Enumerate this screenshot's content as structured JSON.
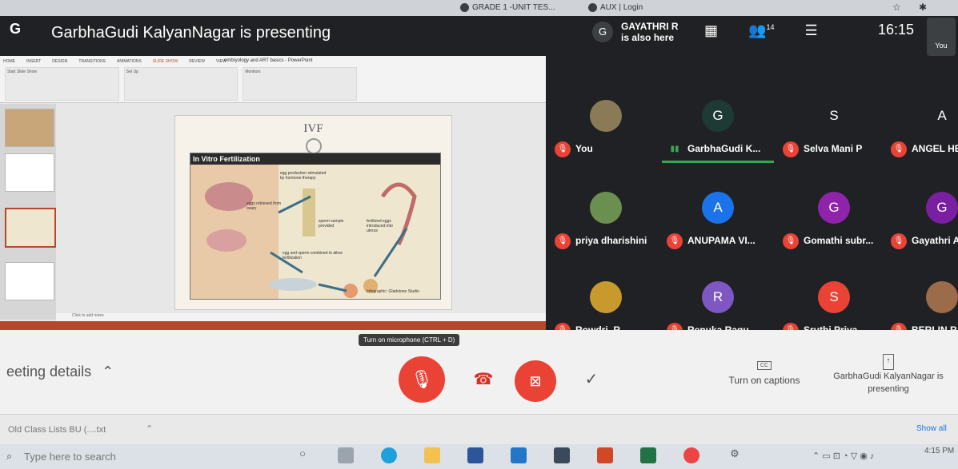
{
  "browser": {
    "tab1": "GRADE 1 -UNIT TES...",
    "tab2": "AUX | Login"
  },
  "header": {
    "logo": "G",
    "presenting_title": "GarbhaGudi KalyanNagar is presenting",
    "also_here_avatar": "G",
    "also_here_name": "GAYATHRI R",
    "also_here_text": "is also here",
    "people_count": "14",
    "time": "16:15",
    "you_label": "You"
  },
  "slide": {
    "ribbon_tabs": [
      "HOME",
      "INSERT",
      "DESIGN",
      "TRANSITIONS",
      "ANIMATIONS",
      "SLIDE SHOW",
      "REVIEW",
      "VIEW"
    ],
    "ribbon_title": "embryology and ART basics - PowerPoint",
    "groups": [
      "Start Slide Show",
      "Set Up",
      "Monitors"
    ],
    "title": "IVF",
    "panel_header": "In Vitro Fertilization",
    "steps": [
      "egg production stimulated by hormone therapy",
      "eggs retrieved from ovary",
      "sperm sample provided",
      "fertilized eggs introduced into uterus",
      "egg and sperm combined to allow fertilization"
    ],
    "notes_placeholder": "Click to add notes",
    "footer_credit": "Infographic: Gladstone Studio"
  },
  "participants": [
    {
      "name": "You",
      "initial": "",
      "color": "#8a7a55"
    },
    {
      "name": "GarbhaGudi K...",
      "initial": "G",
      "color": "#1e3a34"
    },
    {
      "name": "Selva Mani P",
      "initial": "S",
      "color": "#202124"
    },
    {
      "name": "ANGEL HE",
      "initial": "A",
      "color": "#202124"
    },
    {
      "name": "priya dharishini",
      "initial": "",
      "color": "#6b8f4e"
    },
    {
      "name": "ANUPAMA VI...",
      "initial": "A",
      "color": "#1a73e8"
    },
    {
      "name": "Gomathi subr...",
      "initial": "G",
      "color": "#8e24aa"
    },
    {
      "name": "Gayathri A",
      "initial": "G",
      "color": "#7b1fa2"
    },
    {
      "name": "Rowdri. R",
      "initial": "",
      "color": "#c89a2e"
    },
    {
      "name": "Renuka Ragu...",
      "initial": "R",
      "color": "#7e57c2"
    },
    {
      "name": "Sruthi Priya",
      "initial": "S",
      "color": "#ea4335"
    },
    {
      "name": "BERLIN RA",
      "initial": "",
      "color": "#9c6b4a"
    }
  ],
  "controls": {
    "tooltip": "Turn on microphone (CTRL + D)",
    "meeting_details": "eeting details",
    "captions_label": "Turn on captions",
    "cc": "CC",
    "presenting_label": "GarbhaGudi KalyanNagar is presenting"
  },
  "downloads": {
    "file": "Old Class Lists BU (....txt",
    "show_all": "Show all"
  },
  "taskbar": {
    "search_placeholder": "Type here to search",
    "time": "4:15 PM"
  }
}
